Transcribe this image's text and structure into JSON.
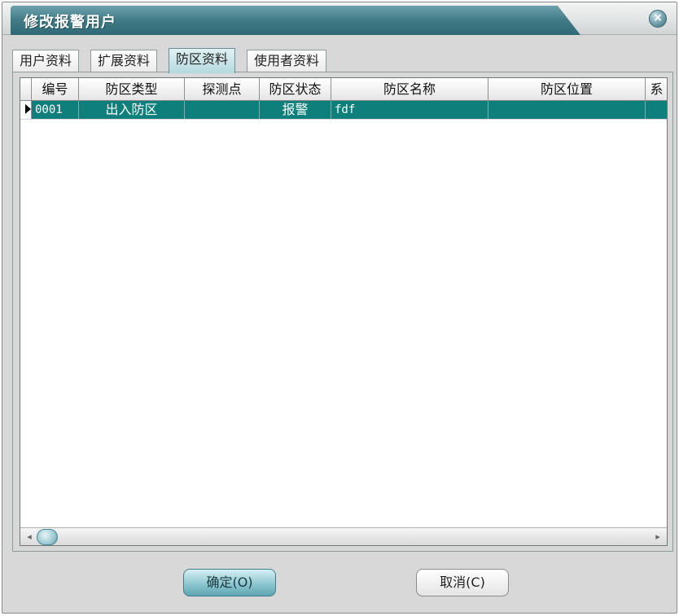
{
  "window": {
    "title": "修改报警用户",
    "close_label": "×"
  },
  "tabs": [
    {
      "label": "用户资料",
      "active": false
    },
    {
      "label": "扩展资料",
      "active": false
    },
    {
      "label": "防区资料",
      "active": true
    },
    {
      "label": "使用者资料",
      "active": false
    }
  ],
  "grid": {
    "columns": [
      "编号",
      "防区类型",
      "探测点",
      "防区状态",
      "防区名称",
      "防区位置",
      "系"
    ],
    "rows": [
      {
        "cells": [
          "0001",
          "出入防区",
          "",
          "报警",
          "fdf",
          "",
          ""
        ],
        "selected": true
      }
    ],
    "scrollbar": {
      "left_arrow": "◂",
      "right_arrow": "▸"
    }
  },
  "buttons": {
    "ok_label": "确定(O)",
    "cancel_label": "取消(C)"
  },
  "colors": {
    "accent": "#3f7b87",
    "selected_row": "#0f7f7c"
  }
}
